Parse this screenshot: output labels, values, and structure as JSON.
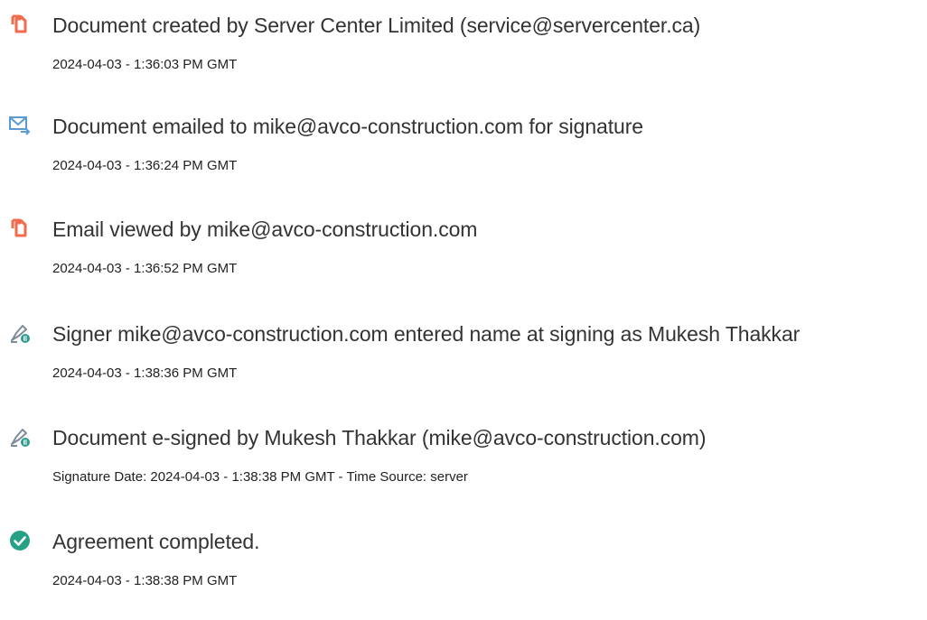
{
  "colors": {
    "document_icon": "#f26b4c",
    "email_icon": "#5b9bd5",
    "signer_icon": "#7e8c99",
    "signer_badge": "#2a9d8f",
    "completed_icon": "#27a186"
  },
  "events": [
    {
      "icon": "document-icon",
      "title": "Document created by Server Center Limited (service@servercenter.ca)",
      "time": "2024-04-03 - 1:36:03 PM GMT"
    },
    {
      "icon": "email-icon",
      "title": "Document emailed to mike@avco-construction.com for signature",
      "time": "2024-04-03 - 1:36:24 PM GMT"
    },
    {
      "icon": "document-icon",
      "title": "Email viewed by mike@avco-construction.com",
      "time": "2024-04-03 - 1:36:52 PM GMT"
    },
    {
      "icon": "signer-icon",
      "title": "Signer mike@avco-construction.com entered name at signing as Mukesh Thakkar",
      "time": "2024-04-03 - 1:38:36 PM GMT"
    },
    {
      "icon": "signer-icon",
      "title": "Document e-signed by Mukesh Thakkar (mike@avco-construction.com)",
      "time": "Signature Date: 2024-04-03 - 1:38:38 PM GMT - Time Source: server"
    },
    {
      "icon": "check-circle-icon",
      "title": "Agreement completed.",
      "time": "2024-04-03 - 1:38:38 PM GMT"
    }
  ]
}
